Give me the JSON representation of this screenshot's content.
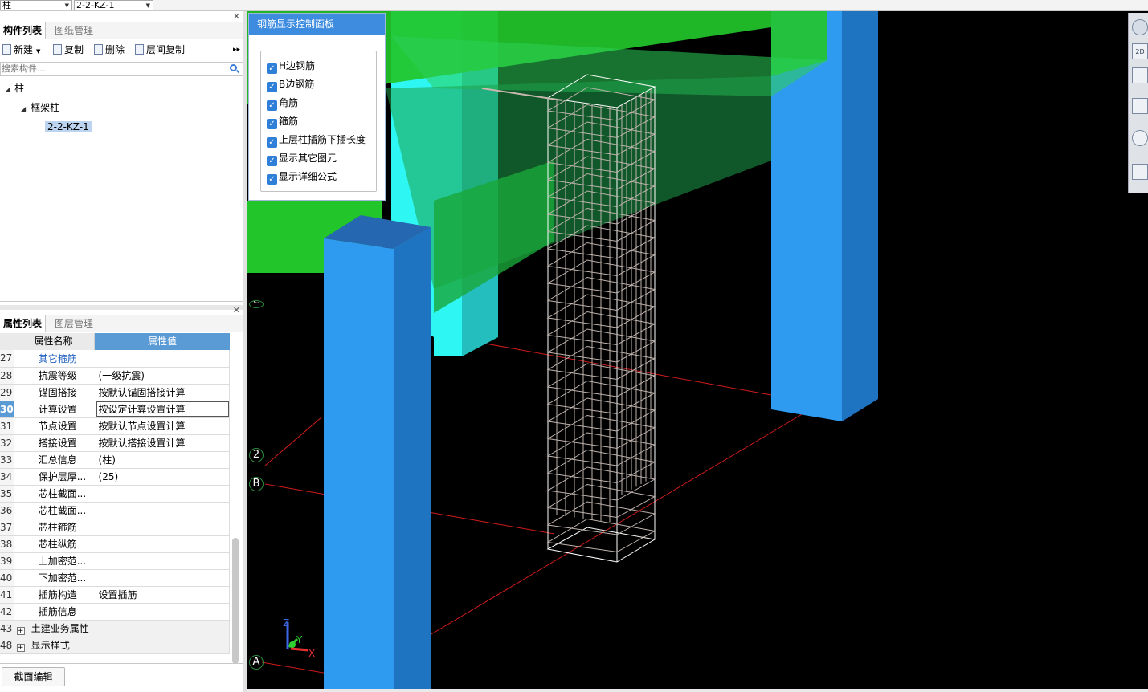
{
  "top": {
    "combo1": "柱",
    "combo2": "2-2-KZ-1"
  },
  "component_panel": {
    "tabs": [
      "构件列表",
      "图纸管理"
    ],
    "toolbar": {
      "new": "新建",
      "copy": "复制",
      "delete": "删除",
      "floor_copy": "层间复制",
      "more": "▸▸"
    },
    "search_placeholder": "搜索构件...",
    "tree": {
      "root": "柱",
      "child": "框架柱",
      "leaf": "2-2-KZ-1"
    }
  },
  "property_panel": {
    "tabs": [
      "属性列表",
      "图层管理"
    ],
    "headers": {
      "name": "属性名称",
      "value": "属性值"
    },
    "rows": [
      {
        "n": "27",
        "k": "其它箍筋",
        "v": ""
      },
      {
        "n": "28",
        "k": "抗震等级",
        "v": "(一级抗震)"
      },
      {
        "n": "29",
        "k": "锚固搭接",
        "v": "按默认锚固搭接计算"
      },
      {
        "n": "30",
        "k": "计算设置",
        "v": "按设定计算设置计算"
      },
      {
        "n": "31",
        "k": "节点设置",
        "v": "按默认节点设置计算"
      },
      {
        "n": "32",
        "k": "搭接设置",
        "v": "按默认搭接设置计算"
      },
      {
        "n": "33",
        "k": "汇总信息",
        "v": "(柱)"
      },
      {
        "n": "34",
        "k": "保护层厚...",
        "v": "(25)"
      },
      {
        "n": "35",
        "k": "芯柱截面...",
        "v": ""
      },
      {
        "n": "36",
        "k": "芯柱截面...",
        "v": ""
      },
      {
        "n": "37",
        "k": "芯柱箍筋",
        "v": ""
      },
      {
        "n": "38",
        "k": "芯柱纵筋",
        "v": ""
      },
      {
        "n": "39",
        "k": "上加密范...",
        "v": ""
      },
      {
        "n": "40",
        "k": "下加密范...",
        "v": ""
      },
      {
        "n": "41",
        "k": "插筋构造",
        "v": "设置插筋"
      },
      {
        "n": "42",
        "k": "插筋信息",
        "v": ""
      },
      {
        "n": "43",
        "k": "土建业务属性",
        "v": ""
      },
      {
        "n": "48",
        "k": "显示样式",
        "v": ""
      }
    ],
    "bottom_button": "截面编辑"
  },
  "rebar_panel": {
    "title": "钢筋显示控制面板",
    "options": [
      "H边钢筋",
      "B边钢筋",
      "角筋",
      "箍筋",
      "上层柱插筋下插长度",
      "显示其它图元",
      "显示详细公式"
    ]
  },
  "viewport": {
    "axis_labels": [
      "2",
      "B",
      "A",
      "C"
    ],
    "gizmo": {
      "z": "Z",
      "y": "Y",
      "x": "X"
    },
    "right_tools": [
      "2D"
    ]
  },
  "colors": {
    "beam_green": "#22c52a",
    "column_blue": "#2f9bf0",
    "column_cyan": "#2ef6f2",
    "accent": "#3d8ce0"
  }
}
